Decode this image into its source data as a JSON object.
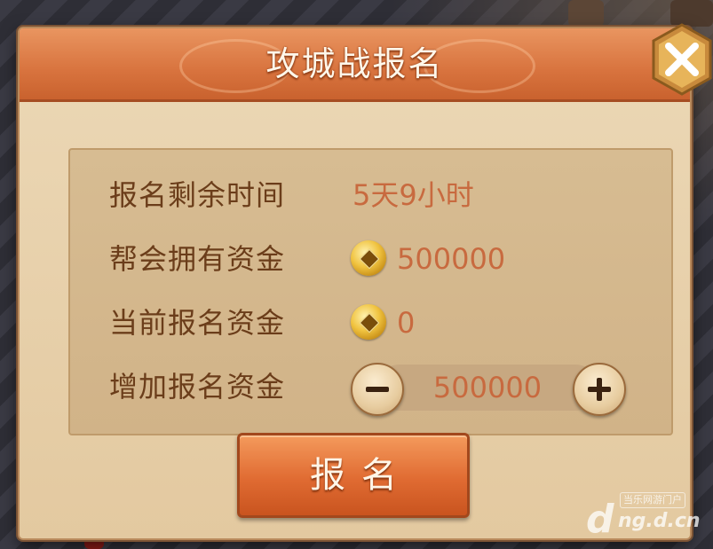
{
  "dialog": {
    "title": "攻城战报名"
  },
  "info_rows": [
    {
      "label": "报名剩余时间",
      "value": "5天9小时",
      "icon": null
    },
    {
      "label": "帮会拥有资金",
      "value": "500000",
      "icon": "coin-icon"
    },
    {
      "label": "当前报名资金",
      "value": "0",
      "icon": "coin-icon"
    }
  ],
  "stepper": {
    "label": "增加报名资金",
    "value": "500000",
    "minus_icon": "minus-icon",
    "plus_icon": "plus-icon"
  },
  "submit_button": {
    "label": "报名"
  },
  "watermark": {
    "small_text": "当乐网游门户",
    "big_text": "ng.d.cn",
    "logo": "d"
  },
  "colors": {
    "title_bar": "#d8733e",
    "label_text": "#6b3d1a",
    "value_text": "#c86a3f",
    "panel_bg": "#d7bc92",
    "button_bg": "#e06b32"
  }
}
